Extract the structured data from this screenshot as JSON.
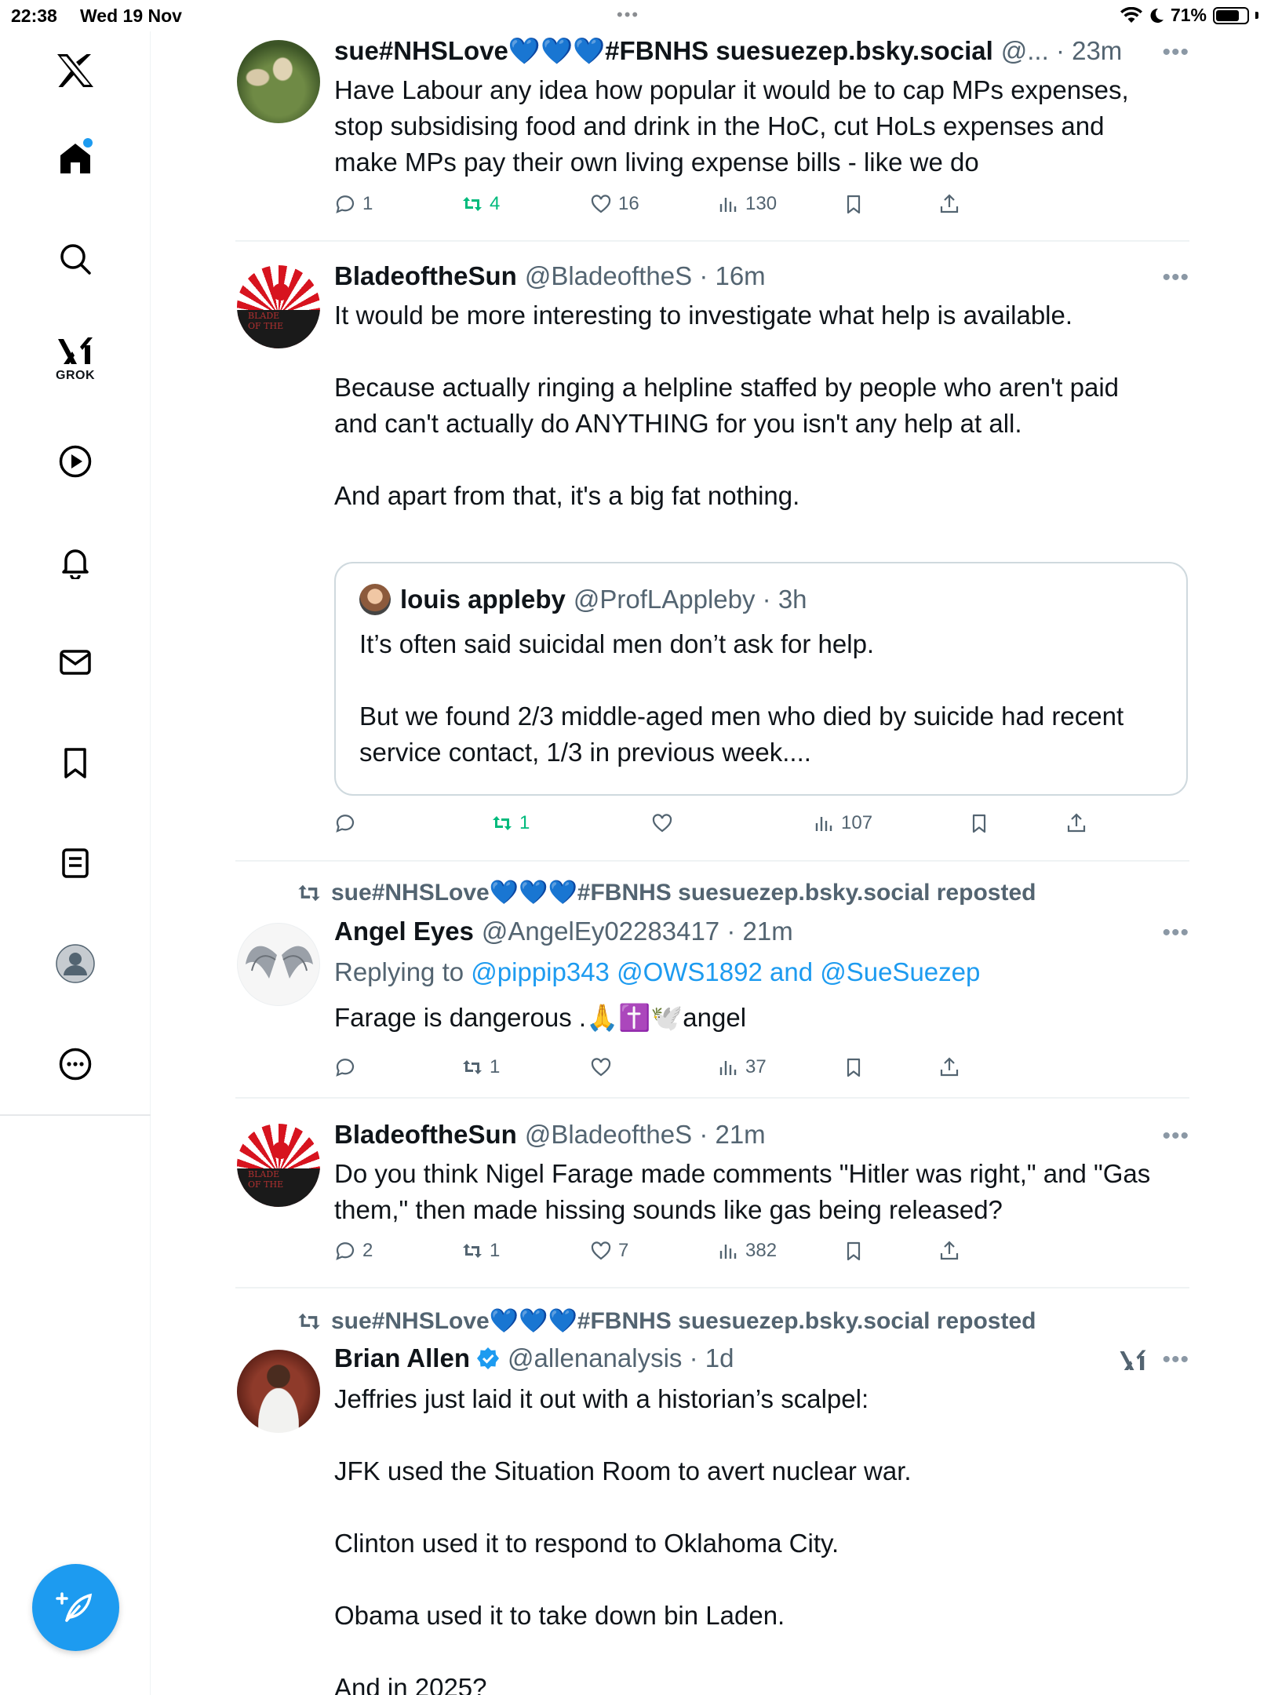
{
  "status_bar": {
    "time": "22:38",
    "date": "Wed 19 Nov",
    "battery": "71%",
    "battery_level": 0.71
  },
  "sidebar": {
    "items": [
      "x-logo",
      "home",
      "search",
      "grok",
      "videos",
      "notifications",
      "messages",
      "bookmarks",
      "lists",
      "profile",
      "more"
    ],
    "grok_label": "GROK"
  },
  "tweets": [
    {
      "name": "sue#NHSLove💙💙💙#FBNHS suesuezep.bsky.social",
      "handle_time": "@... · 23m",
      "lines": [
        "Have Labour any idea how popular it would be to cap MPs expenses,",
        "stop subsidising food and drink in the HoC, cut HoLs expenses and",
        "make MPs pay their own living expense bills - like we do"
      ],
      "replies": "1",
      "reposts": "4",
      "likes": "16",
      "views": "130"
    },
    {
      "name": "BladeoftheSun",
      "handle_time": "@BladeoftheS · 16m",
      "lines": [
        "It would be more interesting to investigate what help is available.",
        "",
        "Because actually ringing a helpline staffed by people who aren't paid",
        "and can't actually do ANYTHING for you isn't any help at all.",
        "",
        "And apart from that, it's a big fat nothing."
      ],
      "quote": {
        "name": "louis appleby",
        "handle_time": "@ProfLAppleby · 3h",
        "lines": [
          "It’s often said suicidal men don’t ask for help.",
          "",
          "But we found 2/3 middle-aged men who died by suicide had recent",
          "service contact, 1/3 in previous week...."
        ]
      },
      "replies": "",
      "reposts": "1",
      "likes": "",
      "views": "107"
    },
    {
      "repost_line": "sue#NHSLove💙💙💙#FBNHS suesuezep.bsky.social reposted",
      "name": "Angel Eyes",
      "handle_time": "@AngelEy02283417 · 21m",
      "replying_label": "Replying to",
      "replying_mentions": "@pippip343 @OWS1892 and @SueSuezep",
      "text": "Farage is dangerous .🙏✝️🕊️angel",
      "replies": "",
      "reposts": "1",
      "likes": "",
      "views": "37"
    },
    {
      "name": "BladeoftheSun",
      "handle_time": "@BladeoftheS · 21m",
      "lines": [
        "Do you think Nigel Farage made comments \"Hitler was right,\" and \"Gas",
        "them,\" then made hissing sounds like gas being released?"
      ],
      "replies": "2",
      "reposts": "1",
      "likes": "7",
      "views": "382"
    },
    {
      "repost_line": "sue#NHSLove💙💙💙#FBNHS suesuezep.bsky.social reposted",
      "name": "Brian Allen",
      "handle_time": "@allenanalysis · 1d",
      "lines": [
        "Jeffries just laid it out with a historian’s scalpel:",
        "",
        "JFK used the Situation Room to avert nuclear war.",
        "",
        "Clinton used it to respond to Oklahoma City.",
        "",
        "Obama used it to take down bin Laden.",
        "",
        "And in 2025?"
      ]
    }
  ],
  "colors": {
    "accent": "#1d9bf0",
    "repost_green": "#00ba7c",
    "secondary_text": "#536471"
  }
}
